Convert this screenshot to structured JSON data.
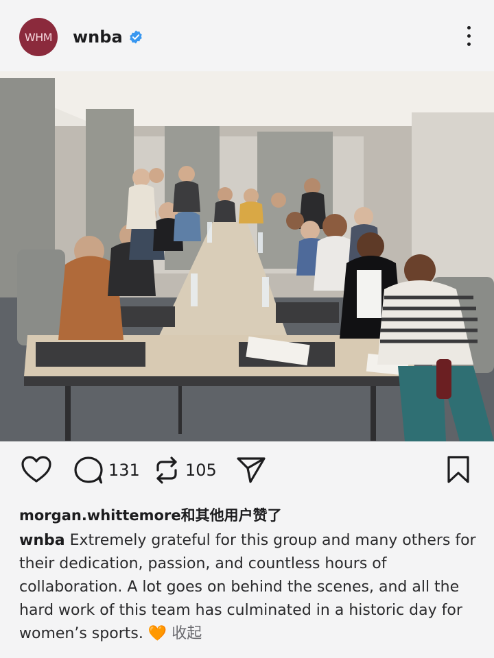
{
  "post": {
    "username": "wnba",
    "avatar_text": "WHM",
    "verified": true
  },
  "actions": {
    "comments_count": "131",
    "reposts_count": "105"
  },
  "liked_by": "morgan.whittemore和其他用户赞了",
  "caption": {
    "author": "wnba",
    "text": "Extremely grateful for this group and many others for their dedication, passion, and countless hours of collaboration. A lot goes on behind the scenes, and all the hard work of this team has culminated in a historic day for women’s sports.",
    "emoji": "🧡",
    "collapse_label": "收起"
  },
  "colors": {
    "avatar_bg": "#8b2a3c",
    "verified_blue": "#3897f0",
    "heart_orange": "#f79a2e"
  },
  "icons": [
    "heart-icon",
    "comment-icon",
    "repost-icon",
    "share-icon",
    "bookmark-icon",
    "more-icon",
    "verified-badge-icon"
  ]
}
